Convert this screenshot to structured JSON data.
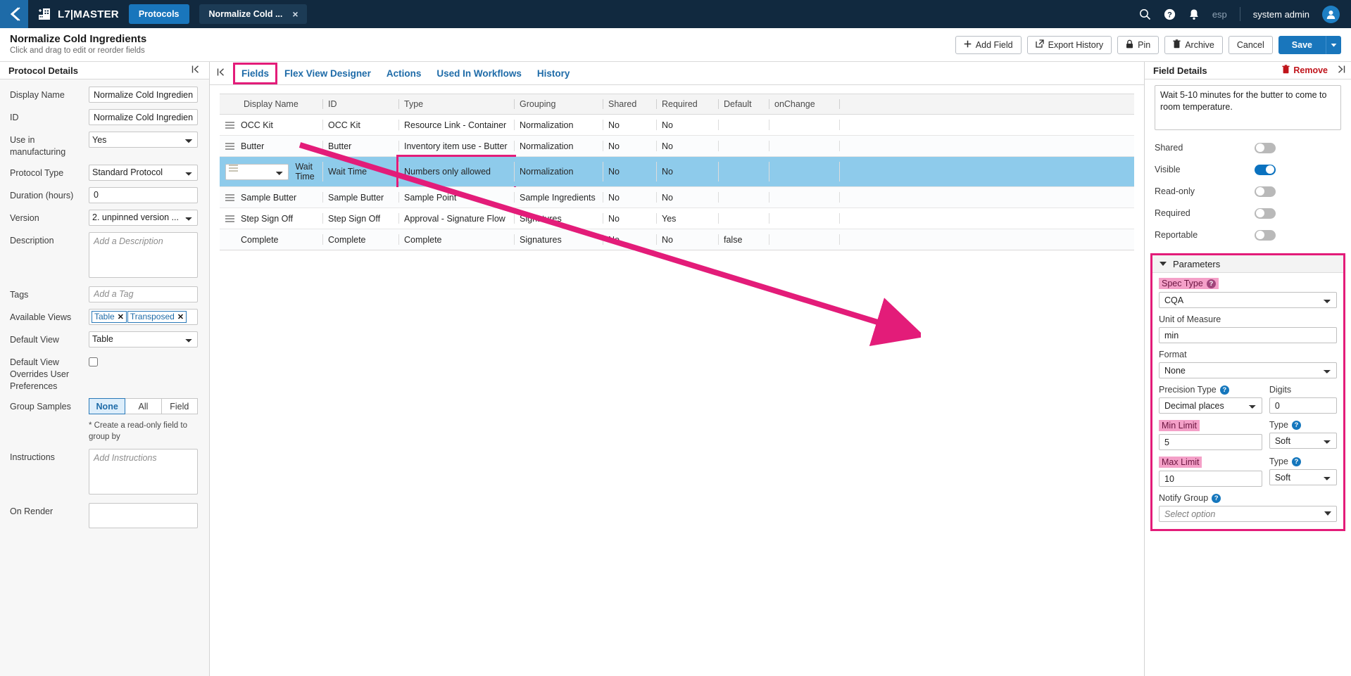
{
  "topnav": {
    "app_title": "L7|MASTER",
    "protocols_chip": "Protocols",
    "open_tab": "Normalize Cold ...",
    "tab_close": "×",
    "lang": "esp",
    "user": "system admin",
    "icons": {
      "search": "search-icon",
      "help": "help-icon",
      "bell": "notification-bell-icon"
    }
  },
  "pagehead": {
    "title": "Normalize Cold Ingredients",
    "subtitle": "Click and drag to edit or reorder fields",
    "add_field": "Add Field",
    "export_history": "Export History",
    "pin": "Pin",
    "archive": "Archive",
    "cancel": "Cancel",
    "save": "Save"
  },
  "left_panel": {
    "title": "Protocol Details",
    "fields": {
      "display_name_label": "Display Name",
      "display_name_value": "Normalize Cold Ingredient",
      "id_label": "ID",
      "id_value": "Normalize Cold Ingredient",
      "use_in_manufacturing_label": "Use in manufacturing",
      "use_in_manufacturing_value": "Yes",
      "protocol_type_label": "Protocol Type",
      "protocol_type_value": "Standard Protocol",
      "duration_label": "Duration (hours)",
      "duration_value": "0",
      "version_label": "Version",
      "version_value": "2. unpinned version ...",
      "description_label": "Description",
      "description_placeholder": "Add a Description",
      "description_value": "",
      "tags_label": "Tags",
      "tags_placeholder": "Add a Tag",
      "tags_value": "",
      "available_views_label": "Available Views",
      "available_views_chips": [
        "Table",
        "Transposed"
      ],
      "default_view_label": "Default View",
      "default_view_value": "Table",
      "default_view_overrides_label": "Default View Overrides User Preferences",
      "default_view_overrides_checked": false,
      "group_samples_label": "Group Samples",
      "group_samples_options": [
        "None",
        "All",
        "Field"
      ],
      "group_samples_selected": "None",
      "group_samples_note": "* Create a read-only field to group by",
      "instructions_label": "Instructions",
      "instructions_placeholder": "Add Instructions",
      "instructions_value": "",
      "on_render_label": "On Render",
      "on_render_value": ""
    }
  },
  "center": {
    "tabs": [
      {
        "label": "Fields",
        "active": true,
        "highlighted": true
      },
      {
        "label": "Flex View Designer",
        "active": false,
        "highlighted": false
      },
      {
        "label": "Actions",
        "active": false,
        "highlighted": false
      },
      {
        "label": "Used In Workflows",
        "active": false,
        "highlighted": false
      },
      {
        "label": "History",
        "active": false,
        "highlighted": false
      }
    ],
    "table": {
      "columns": [
        "Display Name",
        "ID",
        "Type",
        "Grouping",
        "Shared",
        "Required",
        "Default",
        "onChange"
      ],
      "rows": [
        {
          "display_name": "OCC Kit",
          "id": "OCC Kit",
          "type": "Resource Link - Container",
          "grouping": "Normalization",
          "shared": "No",
          "required": "No",
          "default": "",
          "onchange": "",
          "selected": false,
          "draggable": true
        },
        {
          "display_name": "Butter",
          "id": "Butter",
          "type": "Inventory item use - Butter",
          "grouping": "Normalization",
          "shared": "No",
          "required": "No",
          "default": "",
          "onchange": "",
          "selected": false,
          "draggable": true
        },
        {
          "display_name": "Wait Time",
          "id": "Wait Time",
          "type": "Numbers only allowed",
          "grouping": "Normalization",
          "shared": "No",
          "required": "No",
          "default": "",
          "onchange": "",
          "selected": true,
          "draggable": true,
          "type_highlighted": true
        },
        {
          "display_name": "Sample Butter",
          "id": "Sample Butter",
          "type": "Sample Point",
          "grouping": "Sample Ingredients",
          "shared": "No",
          "required": "No",
          "default": "",
          "onchange": "",
          "selected": false,
          "draggable": true
        },
        {
          "display_name": "Step Sign Off",
          "id": "Step Sign Off",
          "type": "Approval - Signature Flow",
          "grouping": "Signatures",
          "shared": "No",
          "required": "Yes",
          "default": "",
          "onchange": "",
          "selected": false,
          "draggable": true
        },
        {
          "display_name": "Complete",
          "id": "Complete",
          "type": "Complete",
          "grouping": "Signatures",
          "shared": "No",
          "required": "No",
          "default": "false",
          "onchange": "",
          "selected": false,
          "draggable": false
        }
      ]
    }
  },
  "right_panel": {
    "title": "Field Details",
    "remove": "Remove",
    "description_value": "Wait 5-10 minutes for the butter to come to room temperature.",
    "toggles": [
      {
        "label": "Shared",
        "on": false
      },
      {
        "label": "Visible",
        "on": true
      },
      {
        "label": "Read-only",
        "on": false
      },
      {
        "label": "Required",
        "on": false
      },
      {
        "label": "Reportable",
        "on": false
      }
    ],
    "parameters": {
      "title": "Parameters",
      "spec_type_label": "Spec Type",
      "spec_type_value": "CQA",
      "unit_of_measure_label": "Unit of Measure",
      "unit_of_measure_value": "min",
      "format_label": "Format",
      "format_value": "None",
      "precision_type_label": "Precision Type",
      "precision_type_value": "Decimal places",
      "digits_label": "Digits",
      "digits_value": "0",
      "min_limit_label": "Min Limit",
      "min_limit_value": "5",
      "min_limit_type_label": "Type",
      "min_limit_type_value": "Soft",
      "max_limit_label": "Max Limit",
      "max_limit_value": "10",
      "max_limit_type_label": "Type",
      "max_limit_type_value": "Soft",
      "notify_group_label": "Notify Group",
      "notify_group_placeholder": "Select option"
    }
  },
  "colors": {
    "nav_bg": "#11293f",
    "accent_blue": "#1976bc",
    "highlight_pink": "#e31c79",
    "row_selected": "#8ecbeb",
    "remove_red": "#c0141b"
  }
}
